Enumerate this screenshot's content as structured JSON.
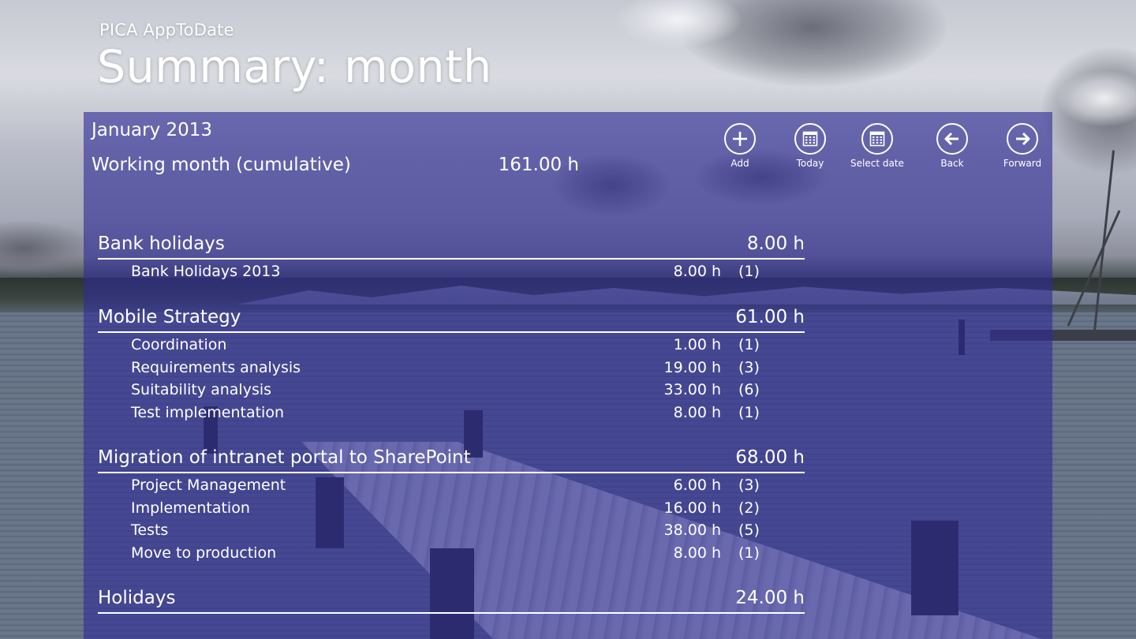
{
  "header": {
    "app_name": "PICA AppToDate",
    "page_title": "Summary: month"
  },
  "summary": {
    "month": "January 2013",
    "cumulative_label": "Working month (cumulative)",
    "cumulative_value": "161.00 h"
  },
  "appbar": {
    "buttons": [
      {
        "label": "Add",
        "icon": "add-icon"
      },
      {
        "label": "Today",
        "icon": "calendar-icon"
      },
      {
        "label": "Select date",
        "icon": "calendar-select-icon"
      },
      {
        "label": "Back",
        "icon": "arrow-left-icon"
      },
      {
        "label": "Forward",
        "icon": "arrow-right-icon"
      }
    ]
  },
  "groups": [
    {
      "name": "Bank holidays",
      "total": "8.00 h",
      "tasks": [
        {
          "name": "Bank Holidays 2013",
          "hours": "8.00 h",
          "count": "(1)"
        }
      ]
    },
    {
      "name": "Mobile Strategy",
      "total": "61.00 h",
      "tasks": [
        {
          "name": "Coordination",
          "hours": "1.00 h",
          "count": "(1)"
        },
        {
          "name": "Requirements analysis",
          "hours": "19.00 h",
          "count": "(3)"
        },
        {
          "name": "Suitability analysis",
          "hours": "33.00 h",
          "count": "(6)"
        },
        {
          "name": "Test implementation",
          "hours": "8.00 h",
          "count": "(1)"
        }
      ]
    },
    {
      "name": "Migration of intranet portal to SharePoint",
      "total": "68.00 h",
      "tasks": [
        {
          "name": "Project Management",
          "hours": "6.00 h",
          "count": "(3)"
        },
        {
          "name": "Implementation",
          "hours": "16.00 h",
          "count": "(2)"
        },
        {
          "name": "Tests",
          "hours": "38.00 h",
          "count": "(5)"
        },
        {
          "name": "Move to production",
          "hours": "8.00 h",
          "count": "(1)"
        }
      ]
    },
    {
      "name": "Holidays",
      "total": "24.00 h",
      "tasks": []
    }
  ]
}
